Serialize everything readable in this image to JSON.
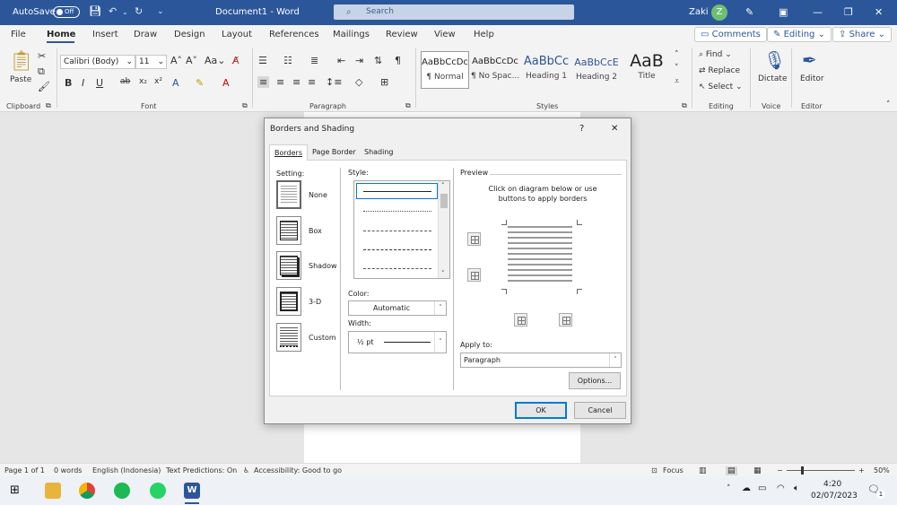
{
  "titlebar": {
    "autosave_label": "AutoSave",
    "autosave_state": "Off",
    "doc_title": "Document1  -  Word",
    "search_placeholder": "Search",
    "user_name": "Zaki",
    "user_initial": "Z"
  },
  "menu": {
    "tabs": [
      "File",
      "Home",
      "Insert",
      "Draw",
      "Design",
      "Layout",
      "References",
      "Mailings",
      "Review",
      "View",
      "Help"
    ],
    "comments": "Comments",
    "editing": "Editing",
    "share": "Share"
  },
  "ribbon": {
    "paste": "Paste",
    "font_name": "Calibri (Body)",
    "font_size": "11",
    "styles": [
      {
        "preview": "AaBbCcDc",
        "name": "¶ Normal"
      },
      {
        "preview": "AaBbCcDc",
        "name": "¶ No Spac..."
      },
      {
        "preview": "AaBbCc",
        "name": "Heading 1"
      },
      {
        "preview": "AaBbCcE",
        "name": "Heading 2"
      },
      {
        "preview": "AaB",
        "name": "Title"
      }
    ],
    "find": "Find",
    "replace": "Replace",
    "select": "Select",
    "dictate": "Dictate",
    "editor": "Editor",
    "groups": [
      "Clipboard",
      "Font",
      "Paragraph",
      "Styles",
      "Editing",
      "Voice",
      "Editor"
    ]
  },
  "dialog": {
    "title": "Borders and Shading",
    "help": "?",
    "close": "✕",
    "tabs": [
      "Borders",
      "Page Border",
      "Shading"
    ],
    "setting_label": "Setting:",
    "settings": [
      "None",
      "Box",
      "Shadow",
      "3-D",
      "Custom"
    ],
    "style_label": "Style:",
    "color_label": "Color:",
    "color_value": "Automatic",
    "width_label": "Width:",
    "width_value": "½ pt",
    "preview_label": "Preview",
    "preview_hint": "Click on diagram below or use buttons to apply borders",
    "apply_label": "Apply to:",
    "apply_value": "Paragraph",
    "options": "Options...",
    "ok": "OK",
    "cancel": "Cancel"
  },
  "statusbar": {
    "page": "Page 1 of 1",
    "words": "0 words",
    "language": "English (Indonesia)",
    "predictions": "Text Predictions: On",
    "accessibility": "Accessibility: Good to go",
    "focus": "Focus",
    "zoom": "50%"
  },
  "taskbar": {
    "time": "4:20",
    "date": "02/07/2023",
    "notification_count": "1"
  },
  "colors": {
    "word_blue": "#2b579a",
    "accent": "#2b579a"
  }
}
